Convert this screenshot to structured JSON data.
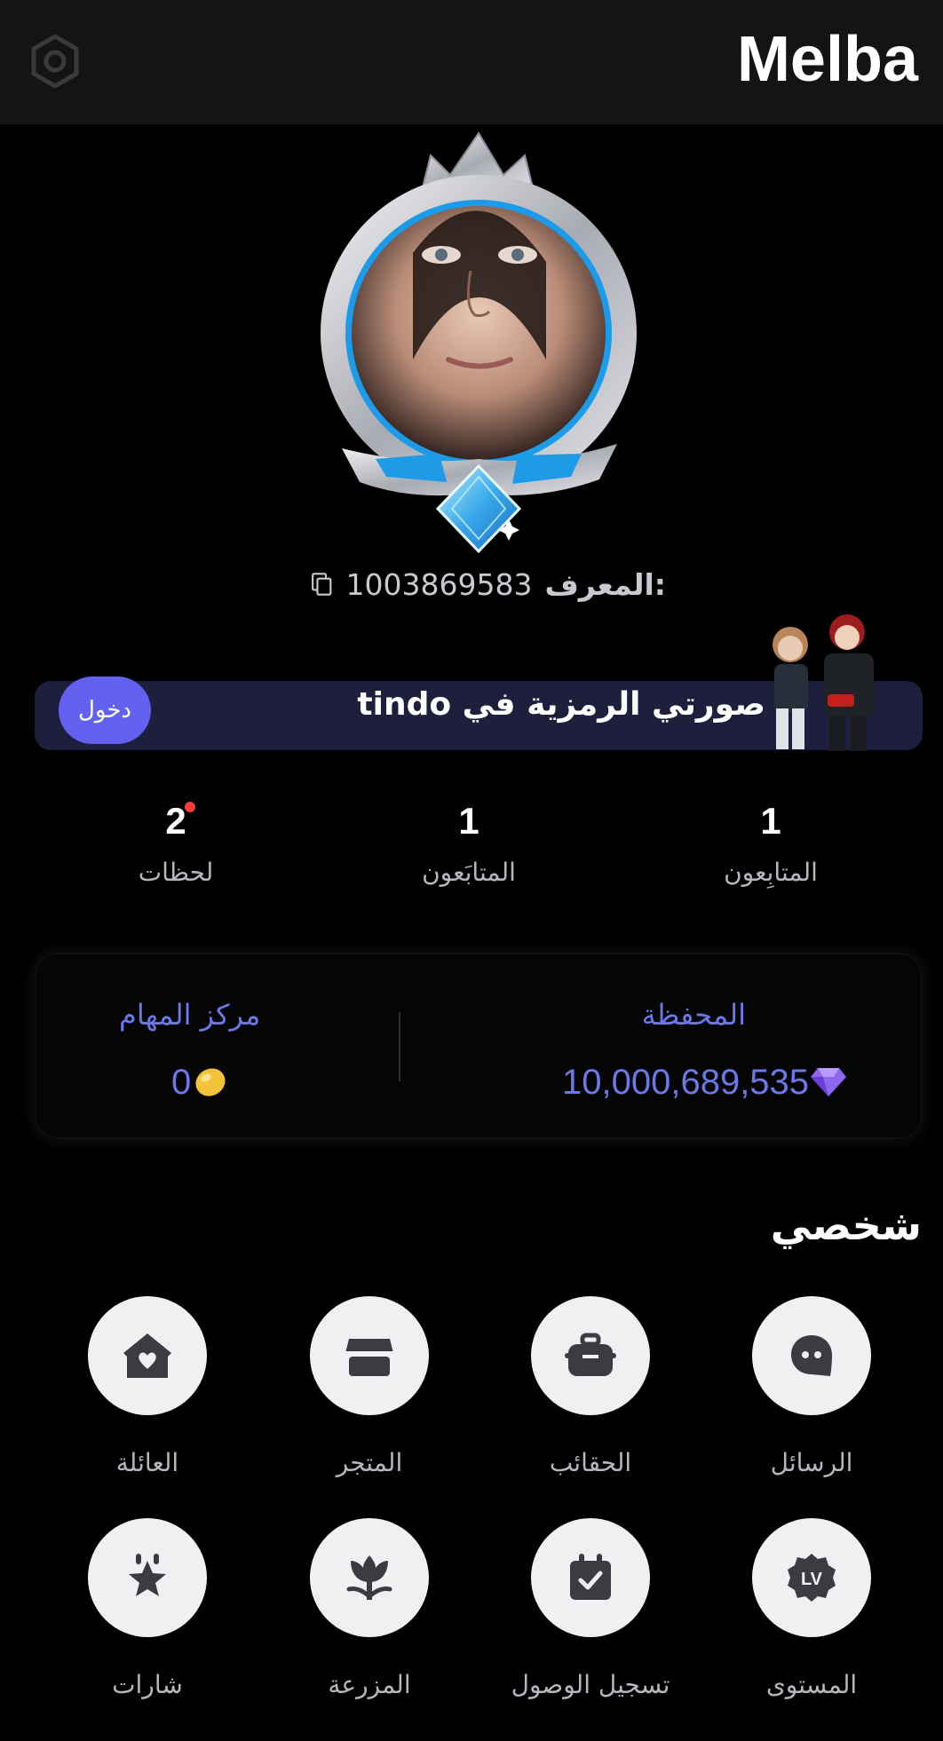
{
  "header": {
    "title": "Melba",
    "settings_icon": "gear-icon"
  },
  "profile": {
    "id_label": "المعرف:",
    "id_value": "1003869583",
    "avatar_frame": "crown-diamond-frame"
  },
  "banner": {
    "text": "صورتي الرمزية في tindo",
    "button_label": "دخول",
    "accent": "#6361f0"
  },
  "stats": [
    {
      "value": "1",
      "label": "المتابِعون"
    },
    {
      "value": "1",
      "label": "المتابَعون"
    },
    {
      "value": "2",
      "label": "لحظات",
      "has_notification": true
    }
  ],
  "wallet": {
    "wallet_title": "المحفظة",
    "wallet_value": "10,000,689,535",
    "wallet_icon": "diamond-icon",
    "tasks_title": "مركز المهام",
    "tasks_value": "0",
    "tasks_icon": "bean-coin-icon",
    "accent": "#6b78e8"
  },
  "personal": {
    "title": "شخصي",
    "items": [
      {
        "label": "الرسائل",
        "icon": "message-icon"
      },
      {
        "label": "الحقائب",
        "icon": "bag-icon"
      },
      {
        "label": "المتجر",
        "icon": "store-icon"
      },
      {
        "label": "العائلة",
        "icon": "family-house-icon"
      },
      {
        "label": "المستوى",
        "icon": "level-badge-icon"
      },
      {
        "label": "تسجيل الوصول",
        "icon": "check-in-calendar-icon"
      },
      {
        "label": "المزرعة",
        "icon": "farm-flower-icon"
      },
      {
        "label": "شارات",
        "icon": "badge-star-icon"
      }
    ]
  }
}
